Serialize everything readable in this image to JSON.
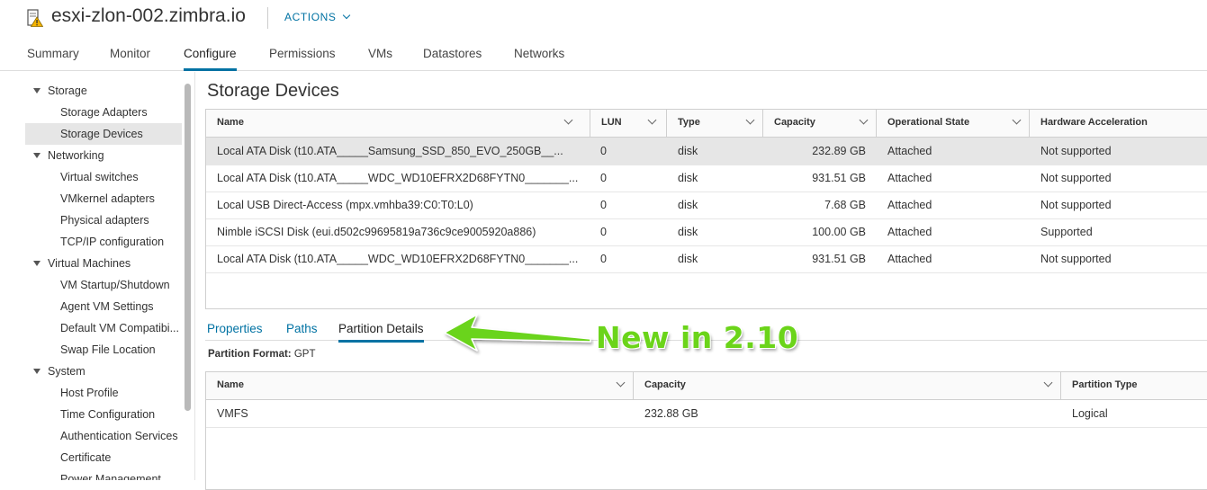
{
  "header": {
    "host_name": "esxi-zlon-002.zimbra.io",
    "actions_label": "ACTIONS"
  },
  "main_tabs": [
    "Summary",
    "Monitor",
    "Configure",
    "Permissions",
    "VMs",
    "Datastores",
    "Networks"
  ],
  "main_tab_active": "Configure",
  "sidebar": {
    "groups": [
      {
        "label": "Storage",
        "items": [
          "Storage Adapters",
          "Storage Devices"
        ]
      },
      {
        "label": "Networking",
        "items": [
          "Virtual switches",
          "VMkernel adapters",
          "Physical adapters",
          "TCP/IP configuration"
        ]
      },
      {
        "label": "Virtual Machines",
        "items": [
          "VM Startup/Shutdown",
          "Agent VM Settings",
          "Default VM Compatibi...",
          "Swap File Location"
        ]
      },
      {
        "label": "System",
        "items": [
          "Host Profile",
          "Time Configuration",
          "Authentication Services",
          "Certificate",
          "Power Management"
        ]
      }
    ],
    "selected_item": "Storage Devices"
  },
  "section_title": "Storage Devices",
  "devices_table": {
    "columns": [
      "Name",
      "LUN",
      "Type",
      "Capacity",
      "Operational State",
      "Hardware Acceleration"
    ],
    "rows": [
      [
        "Local ATA Disk (t10.ATA_____Samsung_SSD_850_EVO_250GB__...",
        "0",
        "disk",
        "232.89 GB",
        "Attached",
        "Not supported"
      ],
      [
        "Local ATA Disk (t10.ATA_____WDC_WD10EFRX2D68FYTN0_______...",
        "0",
        "disk",
        "931.51 GB",
        "Attached",
        "Not supported"
      ],
      [
        "Local USB Direct-Access (mpx.vmhba39:C0:T0:L0)",
        "0",
        "disk",
        "7.68 GB",
        "Attached",
        "Not supported"
      ],
      [
        "Nimble iSCSI Disk (eui.d502c99695819a736c9ce9005920a886)",
        "0",
        "disk",
        "100.00 GB",
        "Attached",
        "Supported"
      ],
      [
        "Local ATA Disk (t10.ATA_____WDC_WD10EFRX2D68FYTN0_______...",
        "0",
        "disk",
        "931.51 GB",
        "Attached",
        "Not supported"
      ]
    ],
    "selected_row": 0
  },
  "detail_tabs": [
    "Properties",
    "Paths",
    "Partition Details"
  ],
  "detail_tab_active": "Partition Details",
  "partition_format": {
    "label": "Partition Format:",
    "value": "GPT"
  },
  "partitions_table": {
    "columns": [
      "Name",
      "Capacity",
      "Partition Type"
    ],
    "rows": [
      [
        "VMFS",
        "232.88 GB",
        "Logical"
      ]
    ]
  },
  "annotation": {
    "text": "New in 2.10",
    "color": "#6bd41a"
  },
  "colors": {
    "accent": "#0072a3",
    "selected_bg": "#e6e6e6",
    "warning": "#f5b400"
  },
  "icons": {
    "host": "host-warning-icon",
    "actions": "chevron-down-icon",
    "tree": "caret-down-icon",
    "sort": "chevron-down-icon"
  }
}
